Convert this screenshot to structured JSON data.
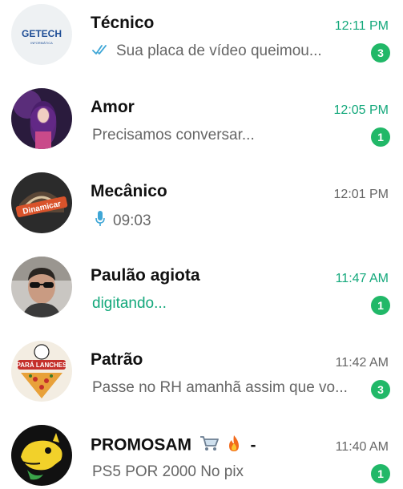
{
  "colors": {
    "accent_green": "#13a87b",
    "badge_green": "#21b868",
    "muted_text": "#666666",
    "tick_blue": "#3ea6d6"
  },
  "chats": [
    {
      "name": "Técnico",
      "time": "12:11 PM",
      "preview": "Sua placa de vídeo queimou...",
      "unread_count": "3",
      "avatar_text": "GETECH",
      "avatar_subtext": "INFORMÁTICA",
      "preview_icon": "double-check-icon"
    },
    {
      "name": "Amor",
      "time": "12:05 PM",
      "preview": "Precisamos conversar...",
      "unread_count": "1"
    },
    {
      "name": "Mecânico",
      "time": "12:01 PM",
      "preview": "09:03",
      "avatar_text": "Dinamicar",
      "preview_icon": "microphone-icon"
    },
    {
      "name": "Paulão agiota",
      "time": "11:47 AM",
      "preview": "digitando...",
      "unread_count": "1"
    },
    {
      "name": "Patrão",
      "time": "11:42 AM",
      "preview": "Passe no RH amanhã assim que vo...",
      "unread_count": "3",
      "avatar_text": "PARÁ LANCHES"
    },
    {
      "name": "PROMOSAM",
      "name_suffix": "-",
      "name_icons": [
        "shopping-cart-icon",
        "fire-icon"
      ],
      "time": "11:40 AM",
      "preview": "PS5 POR 2000 No pix",
      "unread_count": "1"
    }
  ]
}
